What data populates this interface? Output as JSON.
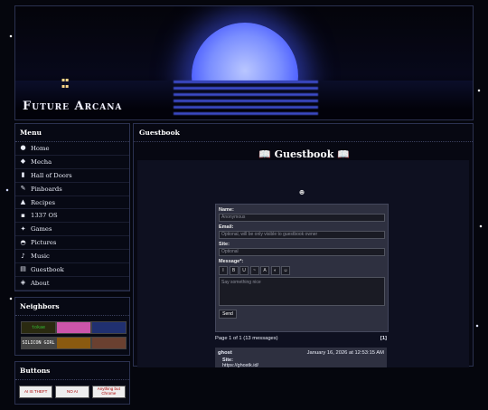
{
  "site": {
    "title": "Future Arcana"
  },
  "menu": {
    "title": "Menu",
    "items": [
      {
        "label": "Home",
        "icon": "home-icon",
        "glyph": "●"
      },
      {
        "label": "Mecha",
        "icon": "mecha-icon",
        "glyph": "◆"
      },
      {
        "label": "Hall of Doors",
        "icon": "door-icon",
        "glyph": "▮"
      },
      {
        "label": "Pinboards",
        "icon": "pin-icon",
        "glyph": "✎"
      },
      {
        "label": "Recipes",
        "icon": "recipe-icon",
        "glyph": "▲"
      },
      {
        "label": "1337 OS",
        "icon": "os-icon",
        "glyph": "▪"
      },
      {
        "label": "Games",
        "icon": "games-icon",
        "glyph": "✦"
      },
      {
        "label": "Pictures",
        "icon": "pictures-icon",
        "glyph": "◓"
      },
      {
        "label": "Music",
        "icon": "music-icon",
        "glyph": "♪"
      },
      {
        "label": "Guestbook",
        "icon": "guestbook-icon",
        "glyph": "▤"
      },
      {
        "label": "About",
        "icon": "about-icon",
        "glyph": "◈"
      }
    ]
  },
  "neighbors": {
    "title": "Neighbors",
    "badges": [
      {
        "label": "tokae",
        "color": "#3b3",
        "bg": "#2a2a10"
      },
      {
        "label": "",
        "color": "#fff",
        "bg": "#c5a"
      },
      {
        "label": "",
        "color": "#fff",
        "bg": "#203070"
      },
      {
        "label": "SILICON GIRL",
        "color": "#fff",
        "bg": "#444"
      },
      {
        "label": "",
        "color": "#ffd200",
        "bg": "#8a5a10"
      },
      {
        "label": "",
        "color": "#fff",
        "bg": "#6a4030"
      }
    ]
  },
  "buttons_box": {
    "title": "Buttons",
    "badges": [
      {
        "label": "AI IS THEFT"
      },
      {
        "label": "NO AI"
      },
      {
        "label": "Anything but Chrome"
      }
    ]
  },
  "main": {
    "box_title": "Guestbook",
    "heading": "📖 Guestbook 📖",
    "icon_glyph": "☻",
    "form": {
      "name_label": "Name:",
      "name_placeholder": "Anonymous",
      "email_label": "Email:",
      "email_placeholder": "Optional, will be only visible to guestbook owner",
      "site_label": "Site:",
      "site_placeholder": "Optional",
      "message_label": "Message*:",
      "message_placeholder": "Say something nice",
      "toolbar": [
        "I",
        "B",
        "U",
        "~",
        "A",
        "◐",
        "☺"
      ],
      "send_label": "Send"
    },
    "pager": {
      "summary": "Page 1 of 1 (13 messages)",
      "page": "[1]"
    },
    "entry": {
      "name": "ghost",
      "date": "January 16, 2026 at 12:53:15 AM",
      "site_label": "Site:",
      "site_value": "https://ghostk.id/"
    }
  }
}
